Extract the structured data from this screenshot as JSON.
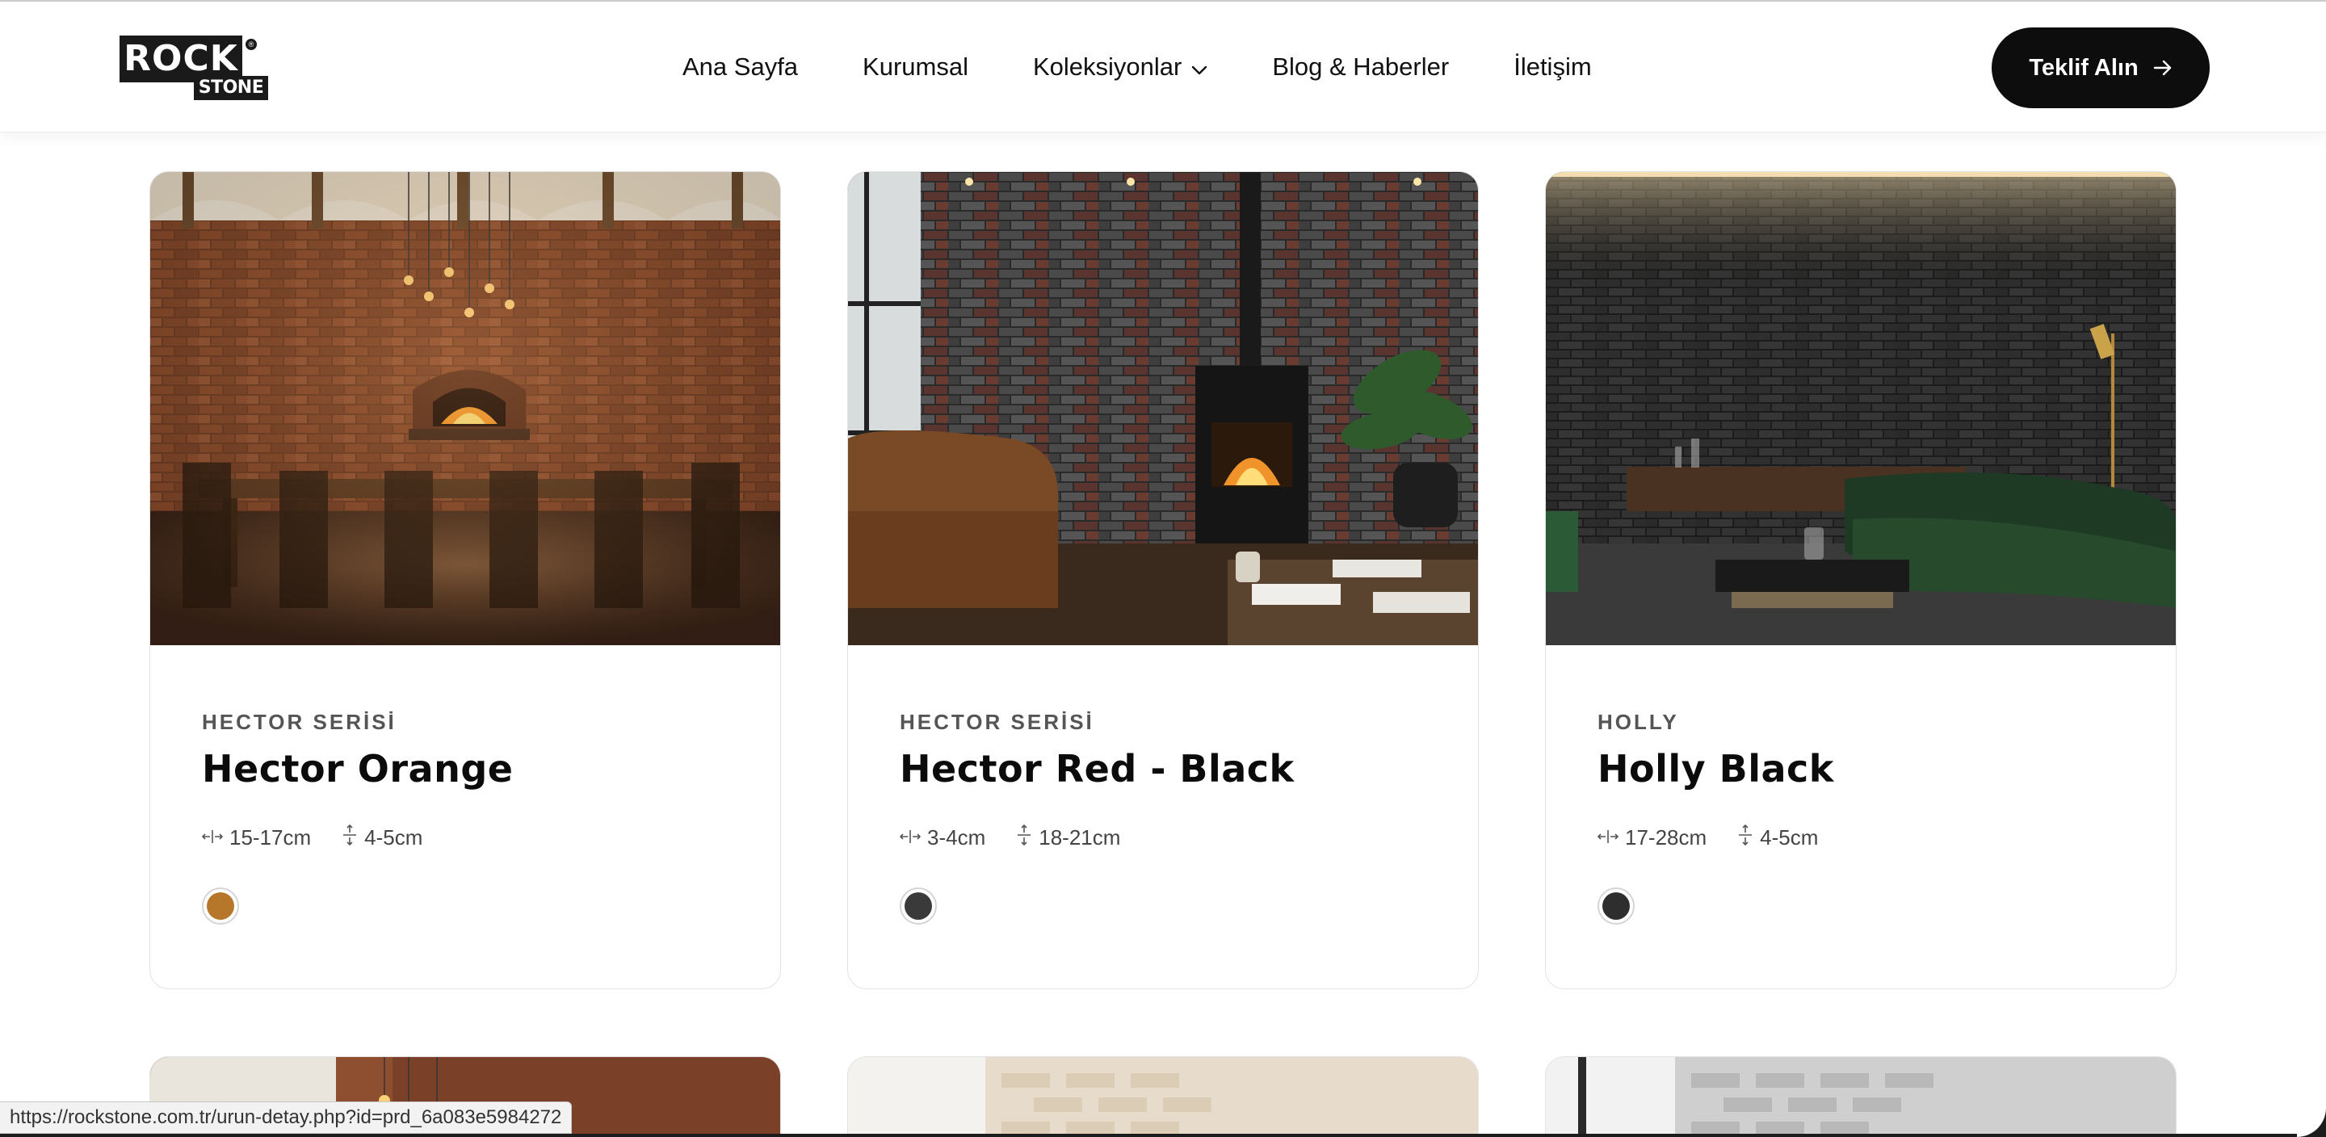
{
  "header": {
    "logo_main": "ROCK",
    "logo_sub": "STONE",
    "logo_reg": "®",
    "nav": [
      {
        "label": "Ana Sayfa"
      },
      {
        "label": "Kurumsal"
      },
      {
        "label": "Koleksiyonlar",
        "has_dropdown": true
      },
      {
        "label": "Blog & Haberler"
      },
      {
        "label": "İletişim"
      }
    ],
    "cta_label": "Teklif Alın",
    "cta_icon": "arrow-right-icon"
  },
  "products": [
    {
      "series": "HECTOR SERİSİ",
      "name": "Hector Orange",
      "width": "15-17cm",
      "height": "4-5cm",
      "swatch_color": "#b7772b",
      "image": "brick dining room with pizza oven"
    },
    {
      "series": "HECTOR SERİSİ",
      "name": "Hector Red - Black",
      "width": "3-4cm",
      "height": "18-21cm",
      "swatch_color": "#3a3a3a",
      "image": "grey-red brick living room with stove fireplace"
    },
    {
      "series": "HOLLY",
      "name": "Holly Black",
      "width": "17-28cm",
      "height": "4-5cm",
      "swatch_color": "#2e2e2e",
      "image": "black brick lounge with green sofa"
    }
  ],
  "status_url": "https://rockstone.com.tr/urun-detay.php?id=prd_6a083e5984272",
  "colors": {
    "brand": "#0d0d0d",
    "text": "#111111",
    "muted": "#555555",
    "border": "#e3e3e3"
  }
}
